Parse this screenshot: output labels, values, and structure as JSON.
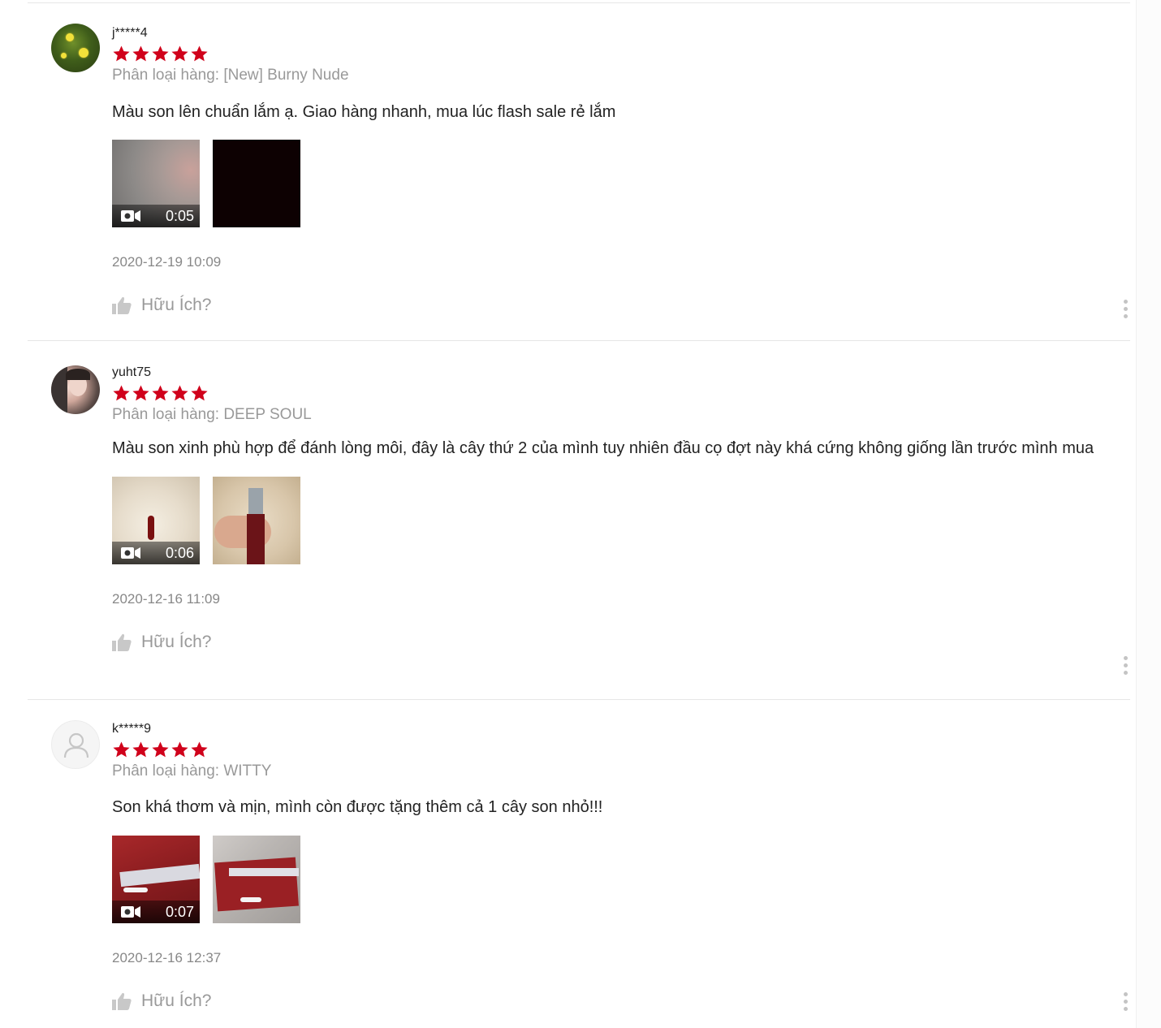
{
  "reviews": [
    {
      "username": "j*****4",
      "rating": 5,
      "variation": "Phân loại hàng: [New] Burny Nude",
      "comment": "Màu son lên chuẩn lắm ạ. Giao hàng nhanh, mua lúc flash sale rẻ lắm",
      "video_duration": "0:05",
      "timestamp": "2020-12-19 10:09",
      "helpful_label": "Hữu Ích?"
    },
    {
      "username": "yuht75",
      "rating": 5,
      "variation": "Phân loại hàng: DEEP SOUL",
      "comment": "Màu son xinh phù hợp để đánh lòng môi, đây là cây thứ 2 của mình tuy nhiên đầu cọ đợt này khá cứng không giống lần trước mình mua",
      "video_duration": "0:06",
      "timestamp": "2020-12-16 11:09",
      "helpful_label": "Hữu Ích?"
    },
    {
      "username": "k*****9",
      "rating": 5,
      "variation": "Phân loại hàng: WITTY",
      "comment": "Son khá thơm và mịn, mình còn được tặng thêm cả 1 cây son nhỏ!!!",
      "video_duration": "0:07",
      "timestamp": "2020-12-16 12:37",
      "helpful_label": "Hữu Ích?"
    }
  ],
  "colors": {
    "star": "#d0011b",
    "muted_text": "#999999",
    "divider": "#e6e6e6"
  },
  "icons": [
    "star-icon",
    "video-camera-icon",
    "thumbs-up-icon",
    "more-vertical-icon",
    "user-placeholder-icon"
  ]
}
